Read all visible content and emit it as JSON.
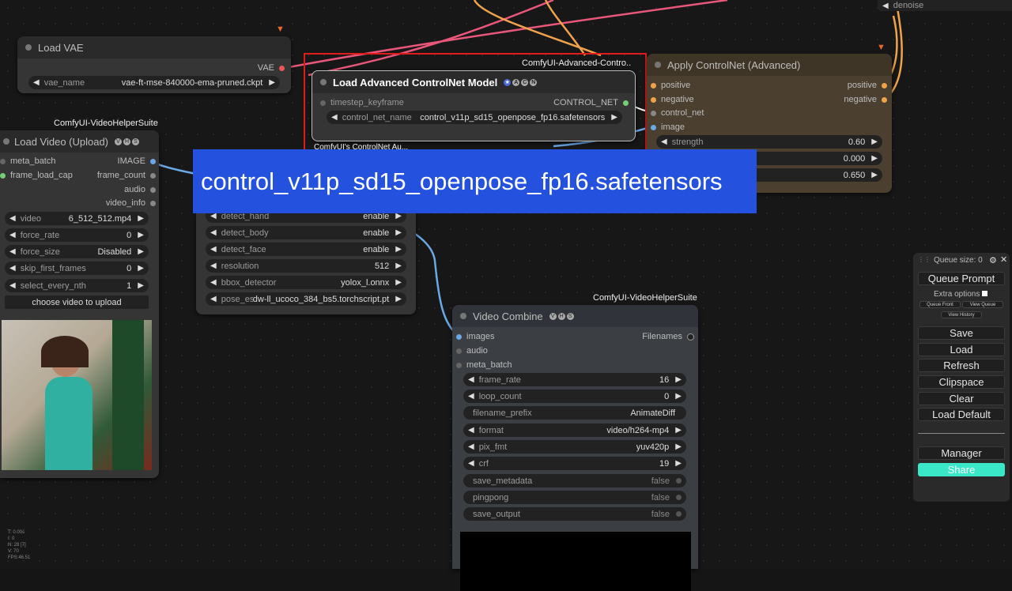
{
  "load_vae": {
    "title": "Load VAE",
    "output": "VAE",
    "vae_name_label": "vae_name",
    "vae_name_value": "vae-ft-mse-840000-ema-pruned.ckpt"
  },
  "load_controlnet": {
    "pack": "ComfyUI-Advanced-Contro..",
    "title": "Load Advanced ControlNet Model",
    "input_timestep": "timestep_keyframe",
    "output": "CONTROL_NET",
    "control_net_name_label": "control_net_name",
    "control_net_name_value": "control_v11p_sd15_openpose_fp16.safetensors",
    "pack_below": "ComfyUI's ControlNet Au..."
  },
  "apply_controlnet": {
    "title": "Apply ControlNet (Advanced)",
    "inputs": [
      "positive",
      "negative",
      "control_net",
      "image"
    ],
    "outputs": [
      "positive",
      "negative"
    ],
    "strength_label": "strength",
    "strength_value": "0.60",
    "w2_value": "0.000",
    "w3_value": "0.650"
  },
  "denoise_label": "denoise",
  "load_video": {
    "pack": "ComfyUI-VideoHelperSuite",
    "title": "Load Video (Upload)",
    "inputs": [
      "meta_batch",
      "frame_load_cap"
    ],
    "outputs": [
      "IMAGE",
      "frame_count",
      "audio",
      "video_info"
    ],
    "widgets": [
      {
        "label": "video",
        "value": "6_512_512.mp4"
      },
      {
        "label": "force_rate",
        "value": "0"
      },
      {
        "label": "force_size",
        "value": "Disabled"
      },
      {
        "label": "skip_first_frames",
        "value": "0"
      },
      {
        "label": "select_every_nth",
        "value": "1"
      }
    ],
    "upload_button": "choose video to upload"
  },
  "pose_node": {
    "widgets": [
      {
        "label": "detect_hand",
        "value": "enable"
      },
      {
        "label": "detect_body",
        "value": "enable"
      },
      {
        "label": "detect_face",
        "value": "enable"
      },
      {
        "label": "resolution",
        "value": "512"
      },
      {
        "label": "bbox_detector",
        "value": "yolox_l.onnx"
      },
      {
        "label": "pose_estimator",
        "value": "dw-ll_ucoco_384_bs5.torchscript.pt"
      }
    ]
  },
  "video_combine": {
    "pack": "ComfyUI-VideoHelperSuite",
    "title": "Video Combine",
    "inputs": [
      "images",
      "audio",
      "meta_batch"
    ],
    "output": "Filenames",
    "widgets": [
      {
        "label": "frame_rate",
        "value": "16"
      },
      {
        "label": "loop_count",
        "value": "0"
      },
      {
        "label": "filename_prefix",
        "value": "AnimateDiff"
      },
      {
        "label": "format",
        "value": "video/h264-mp4"
      },
      {
        "label": "pix_fmt",
        "value": "yuv420p"
      },
      {
        "label": "crf",
        "value": "19"
      },
      {
        "label": "save_metadata",
        "value": "false"
      },
      {
        "label": "pingpong",
        "value": "false"
      },
      {
        "label": "save_output",
        "value": "false"
      }
    ]
  },
  "tooltip": "control_v11p_sd15_openpose_fp16.safetensors",
  "sidepanel": {
    "queue_size": "Queue size: 0",
    "queue_prompt": "Queue Prompt",
    "extra_options": "Extra options",
    "queue_front": "Queue Front",
    "view_queue": "View Queue",
    "view_history": "View History",
    "buttons": [
      "Save",
      "Load",
      "Refresh",
      "Clipspace",
      "Clear",
      "Load Default"
    ],
    "manager": "Manager",
    "share": "Share"
  },
  "stats": [
    "T: 0.00s",
    "I: 0",
    "N: 28 [7]",
    "V: 70",
    "FPS:46.51"
  ],
  "colors": {
    "accent_red": "#e01b1b",
    "share": "#3ae8c8",
    "tooltip": "#2451de"
  }
}
